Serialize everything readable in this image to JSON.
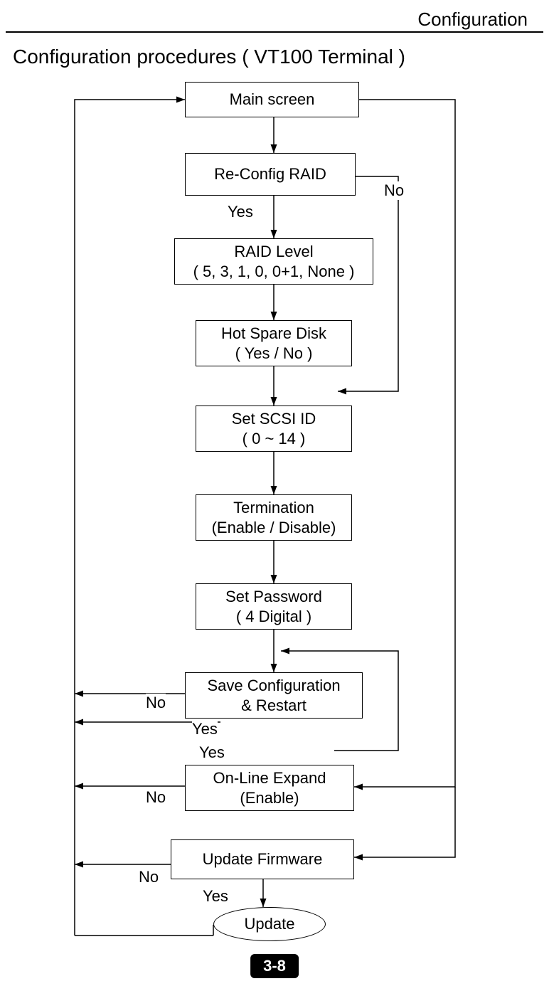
{
  "header": "Configuration",
  "title": "Configuration procedures  ( VT100 Terminal )",
  "nodes": {
    "main": "Main screen",
    "reconfig": "Re-Config RAID",
    "raidlevel_l1": "RAID Level",
    "raidlevel_l2": "( 5, 3, 1, 0, 0+1, None )",
    "hotspare_l1": "Hot Spare Disk",
    "hotspare_l2": "( Yes / No )",
    "scsi_l1": "Set SCSI ID",
    "scsi_l2": "( 0 ~ 14 )",
    "term_l1": "Termination",
    "term_l2": "(Enable / Disable)",
    "pwd_l1": "Set Password",
    "pwd_l2": "( 4 Digital )",
    "save_l1": "Save Configuration",
    "save_l2": "& Restart",
    "expand_l1": "On-Line Expand",
    "expand_l2": "(Enable)",
    "fw": "Update Firmware",
    "update": "Update"
  },
  "labels": {
    "yes": "Yes",
    "no": "No"
  },
  "page": "3-8"
}
